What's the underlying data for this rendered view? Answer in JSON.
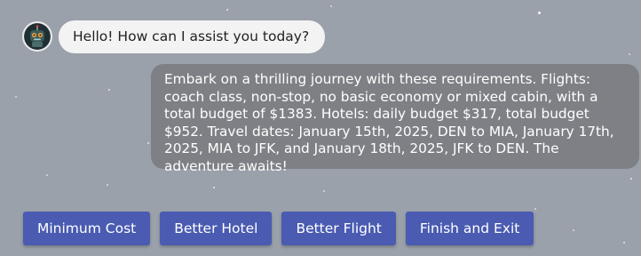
{
  "colors": {
    "background": "#9ba1ab",
    "bot_bubble": "#f3f3f3",
    "user_bubble": "#7e8085",
    "button": "#4a5bb1"
  },
  "chat": {
    "bot": {
      "avatar_icon": "robot-avatar-icon",
      "message": "Hello! How can I assist you today?"
    },
    "user": {
      "message": "Embark on a thrilling journey with these requirements. Flights: coach class, non-stop, no basic economy or mixed cabin, with a total budget of $1383. Hotels: daily budget $317, total budget $952. Travel dates: January 15th, 2025, DEN to MIA, January 17th, 2025, MIA to JFK, and January 18th, 2025, JFK to DEN. The adventure awaits!"
    }
  },
  "actions": {
    "minimum_cost": "Minimum Cost",
    "better_hotel": "Better Hotel",
    "better_flight": "Better Flight",
    "finish_exit": "Finish and Exit"
  }
}
